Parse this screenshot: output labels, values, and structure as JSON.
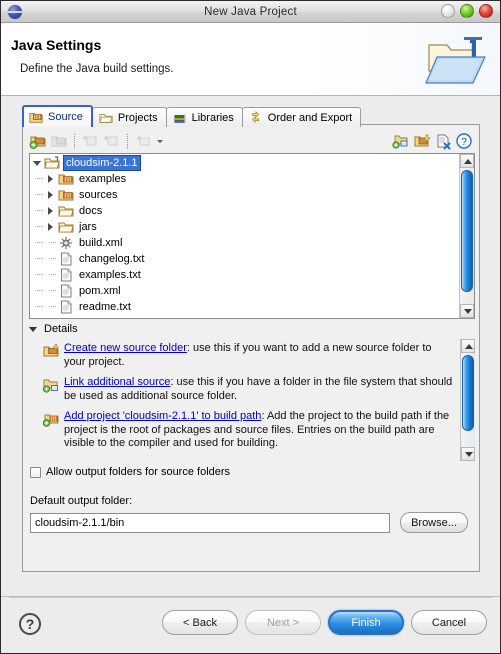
{
  "window": {
    "title": "New Java Project",
    "app_icon": "eclipse-sphere-icon",
    "controls": {
      "minimize": "minimize-button",
      "maximize": "maximize-button",
      "close": "close-button"
    }
  },
  "header": {
    "title": "Java Settings",
    "subtitle": "Define the Java build settings.",
    "graphic": "java-project-folder-icon"
  },
  "tabs": [
    {
      "label": "Source",
      "icon": "source-folder-icon",
      "active": true
    },
    {
      "label": "Projects",
      "icon": "projects-folder-icon",
      "active": false
    },
    {
      "label": "Libraries",
      "icon": "libraries-books-icon",
      "active": false
    },
    {
      "label": "Order and Export",
      "icon": "order-export-arrows-icon",
      "active": false
    }
  ],
  "toolbar": {
    "left": [
      "add-folder-icon",
      "link-source-icon",
      "separator",
      "add-exclusion-icon",
      "add-inclusion-icon",
      "separator",
      "configure-filter-icon",
      "dropdown-caret"
    ],
    "right": [
      "link-source-right-icon",
      "add-folder-right-icon",
      "remove-entry-icon",
      "help-icon"
    ]
  },
  "tree": {
    "items": [
      {
        "label": "cloudsim-2.1.1",
        "icon": "project-folder-icon",
        "twist": "open",
        "level": 1,
        "selected": true
      },
      {
        "label": "examples",
        "icon": "package-folder-icon",
        "twist": "closed",
        "level": 2,
        "selected": false
      },
      {
        "label": "sources",
        "icon": "package-folder-icon",
        "twist": "closed",
        "level": 2,
        "selected": false
      },
      {
        "label": "docs",
        "icon": "plain-folder-icon",
        "twist": "closed",
        "level": 2,
        "selected": false
      },
      {
        "label": "jars",
        "icon": "plain-folder-icon",
        "twist": "closed",
        "level": 2,
        "selected": false
      },
      {
        "label": "build.xml",
        "icon": "ant-build-file-icon",
        "twist": "none",
        "level": 2,
        "selected": false
      },
      {
        "label": "changelog.txt",
        "icon": "text-file-icon",
        "twist": "none",
        "level": 2,
        "selected": false
      },
      {
        "label": "examples.txt",
        "icon": "text-file-icon",
        "twist": "none",
        "level": 2,
        "selected": false
      },
      {
        "label": "pom.xml",
        "icon": "text-file-icon",
        "twist": "none",
        "level": 2,
        "selected": false
      },
      {
        "label": "readme.txt",
        "icon": "text-file-icon",
        "twist": "none",
        "level": 2,
        "selected": false
      }
    ]
  },
  "details": {
    "heading": "Details",
    "entries": [
      {
        "icon": "create-source-folder-icon",
        "link": "Create new source folder",
        "text": ": use this if you want to add a new source folder to your project."
      },
      {
        "icon": "link-additional-source-icon",
        "link": "Link additional source",
        "text": ": use this if you have a folder in the file system that should be used as additional source folder."
      },
      {
        "icon": "add-project-buildpath-icon",
        "link": "Add project 'cloudsim-2.1.1' to build path",
        "text": ": Add the project to the build path if the project is the root of packages and source files. Entries on the build path are visible to the compiler and used for building."
      }
    ]
  },
  "options": {
    "allow_output_folders_label": "Allow output folders for source folders",
    "allow_output_folders_checked": false
  },
  "output": {
    "label": "Default output folder:",
    "value": "cloudsim-2.1.1/bin",
    "browse_label": "Browse..."
  },
  "footer": {
    "help": "?",
    "buttons": [
      {
        "label": "< Back",
        "state": "enabled"
      },
      {
        "label": "Next >",
        "state": "disabled"
      },
      {
        "label": "Finish",
        "state": "default"
      },
      {
        "label": "Cancel",
        "state": "enabled"
      }
    ]
  },
  "colors": {
    "accent": "#3875d7",
    "default_button": "#2d90e4",
    "link": "#0000cc",
    "dialog_bg": "#ececec"
  }
}
